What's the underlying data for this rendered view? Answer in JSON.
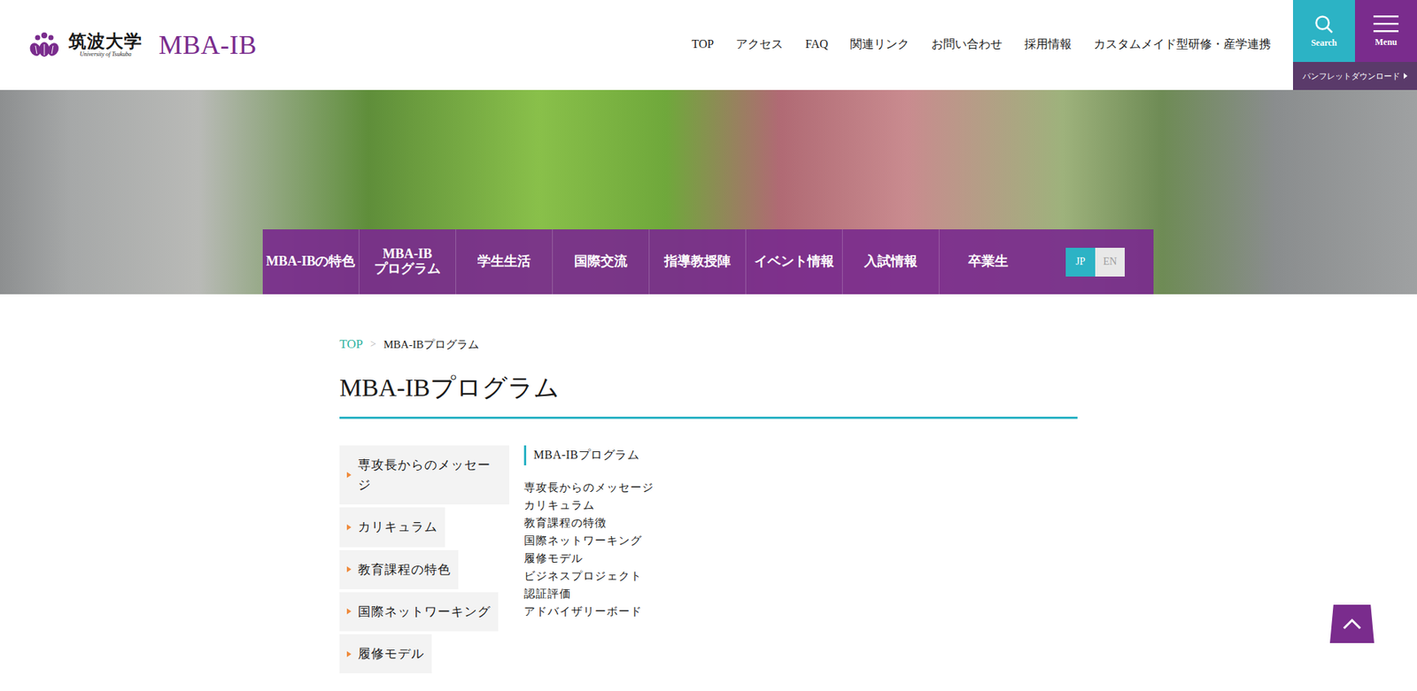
{
  "header": {
    "logo": {
      "university": "筑波大学",
      "university_en": "University of Tsukuba",
      "program": "MBA-IB"
    },
    "top_nav": [
      "TOP",
      "アクセス",
      "FAQ",
      "関連リンク",
      "お問い合わせ",
      "採用情報",
      "カスタムメイド型研修・産学連携"
    ],
    "search_label": "Search",
    "menu_label": "Menu",
    "pamphlet": "パンフレットダウンロード"
  },
  "hero_nav": {
    "items": [
      {
        "lines": [
          "MBA-IBの特色"
        ]
      },
      {
        "lines": [
          "MBA-IB",
          "プログラム"
        ]
      },
      {
        "lines": [
          "学生生活"
        ]
      },
      {
        "lines": [
          "国際交流"
        ]
      },
      {
        "lines": [
          "指導教授陣"
        ]
      },
      {
        "lines": [
          "イベント情報"
        ]
      },
      {
        "lines": [
          "入試情報"
        ]
      },
      {
        "lines": [
          "卒業生"
        ]
      }
    ],
    "languages": [
      {
        "label": "JP",
        "selected": true
      },
      {
        "label": "EN",
        "selected": false
      }
    ]
  },
  "breadcrumb": {
    "items": [
      {
        "label": "TOP",
        "link": true
      },
      {
        "label": "MBA-IBプログラム",
        "link": false
      }
    ],
    "separator": ">"
  },
  "page_title": "MBA-IBプログラム",
  "sidebar": {
    "items": [
      "専攻長からのメッセージ",
      "カリキュラム",
      "教育課程の特色",
      "国際ネットワーキング",
      "履修モデル"
    ]
  },
  "section": {
    "heading": "MBA-IBプログラム",
    "links": [
      "専攻長からのメッセージ",
      "カリキュラム",
      "教育課程の特徴",
      "国際ネットワーキング",
      "履修モデル",
      "ビジネスプロジェクト",
      "認証評価",
      "アドバイザリーボード"
    ]
  }
}
